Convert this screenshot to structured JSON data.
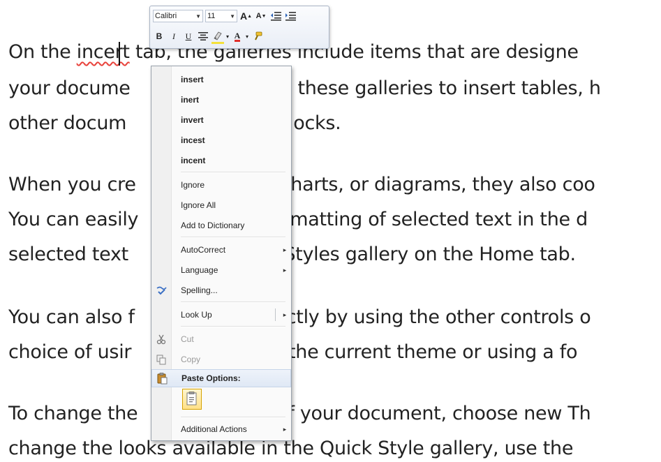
{
  "document": {
    "lines": [
      {
        "pre": "On the ",
        "misspelled": "incert",
        "post": " tab, the galleries include items that are designe"
      },
      {
        "text": "your docume                          e these galleries to insert tables, h"
      },
      {
        "text": "other docum                            locks."
      },
      {
        "text": "When you cre                         charts, or diagrams, they also coo"
      },
      {
        "text": "You can easily                       ormatting of selected text in the d"
      },
      {
        "text": "selected text                        k Styles gallery on the Home tab."
      },
      {
        "text": "You can also f                       rectly by using the other controls o"
      },
      {
        "text": "choice of usir                       m the current theme or using a fo"
      },
      {
        "text": "To change the                        of your document, choose new Th"
      },
      {
        "text": "change the looks available in the Quick Style gallery, use the"
      }
    ]
  },
  "mini_toolbar": {
    "font_name": "Calibri",
    "font_size": "11",
    "grow_font": "A",
    "shrink_font": "A",
    "bold": "B",
    "italic": "I",
    "underline": "U",
    "font_color_letter": "A"
  },
  "context_menu": {
    "suggestions": [
      "insert",
      "inert",
      "invert",
      "incest",
      "incent"
    ],
    "ignore": "Ignore",
    "ignore_all": "Ignore All",
    "add_to_dictionary": "Add to Dictionary",
    "autocorrect": "AutoCorrect",
    "language": "Language",
    "spelling": "Spelling...",
    "look_up": "Look Up",
    "cut": "Cut",
    "copy": "Copy",
    "paste_options": "Paste Options:",
    "additional_actions": "Additional Actions",
    "submenu_arrow": "▸"
  }
}
